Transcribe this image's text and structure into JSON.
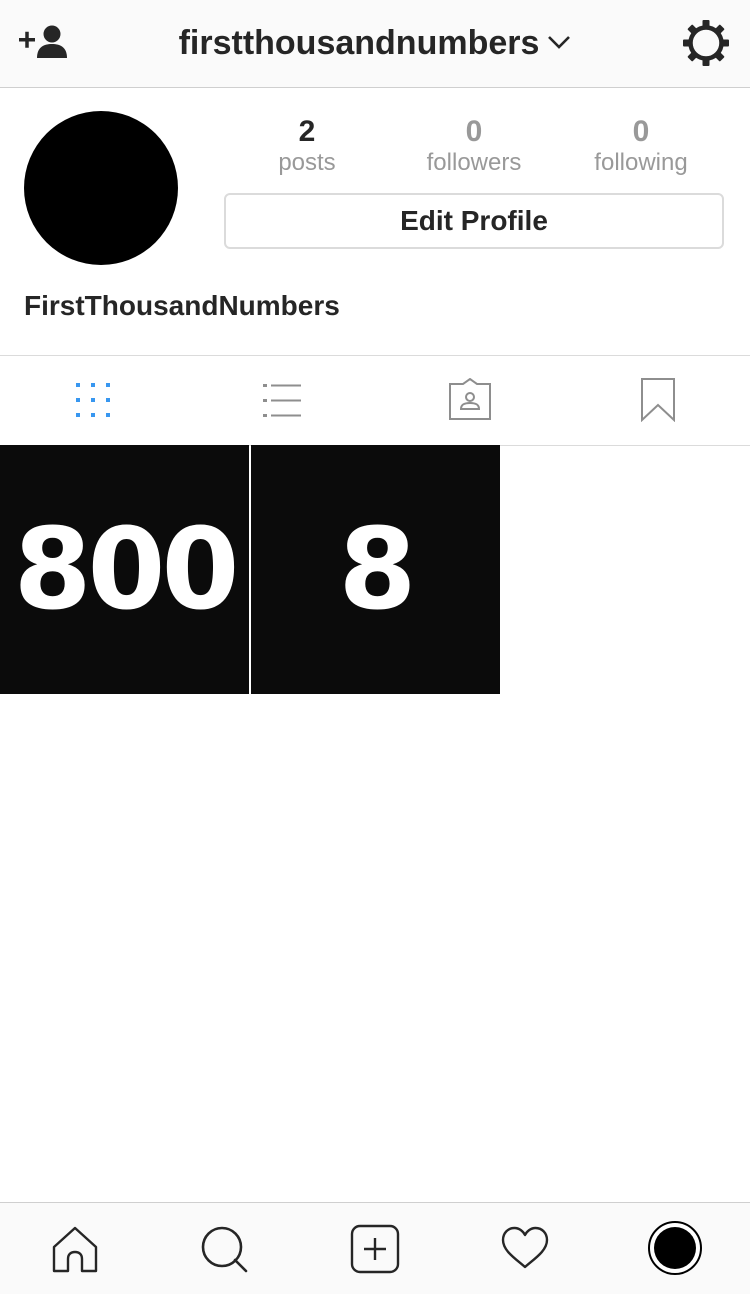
{
  "header": {
    "username": "firstthousandnumbers",
    "icons": [
      "add-user-icon",
      "chevron-down-icon",
      "gear-icon"
    ]
  },
  "profile": {
    "stats": [
      {
        "value": "2",
        "label": "posts"
      },
      {
        "value": "0",
        "label": "followers"
      },
      {
        "value": "0",
        "label": "following"
      }
    ],
    "edit_label": "Edit Profile",
    "full_name": "FirstThousandNumbers"
  },
  "tabs": [
    {
      "icon": "grid-icon",
      "active": true
    },
    {
      "icon": "list-icon",
      "active": false
    },
    {
      "icon": "tagged-icon",
      "active": false
    },
    {
      "icon": "bookmark-icon",
      "active": false
    }
  ],
  "posts": [
    {
      "text": "800"
    },
    {
      "text": "8"
    }
  ],
  "bottom_nav": [
    "home-icon",
    "search-icon",
    "new-post-icon",
    "heart-icon",
    "profile-avatar"
  ],
  "colors": {
    "active_tab": "#3897f0",
    "tile_bg": "#0b0b0b",
    "muted_text": "#999999"
  }
}
